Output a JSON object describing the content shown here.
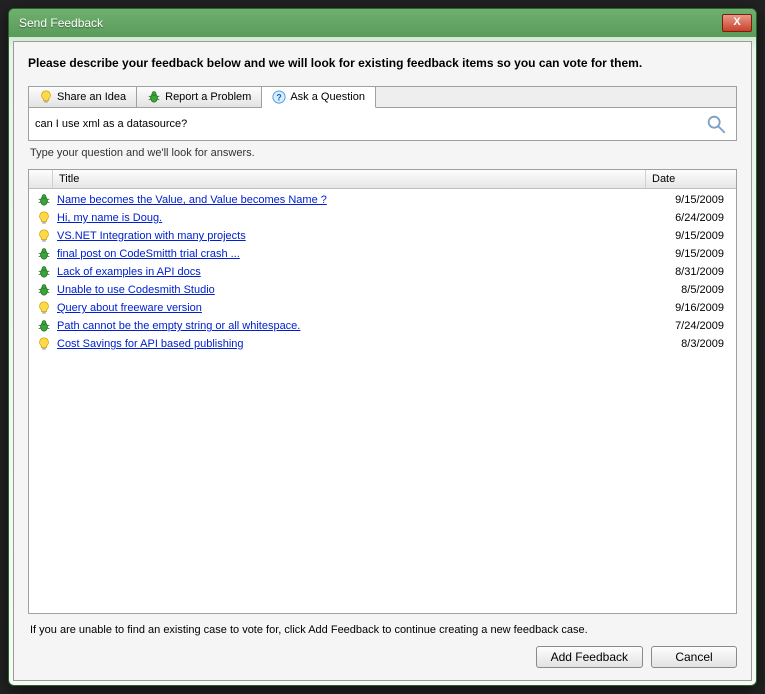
{
  "window": {
    "title": "Send Feedback"
  },
  "headline": "Please describe your feedback below and we will look for existing feedback items so you can vote for them.",
  "tabs": [
    {
      "label": "Share an Idea",
      "icon": "bulb"
    },
    {
      "label": "Report a Problem",
      "icon": "bug"
    },
    {
      "label": "Ask a Question",
      "icon": "question"
    }
  ],
  "active_tab": 2,
  "search": {
    "value": "can I use xml as a datasource?",
    "placeholder": ""
  },
  "hint": "Type your question and we'll look for answers.",
  "columns": {
    "title": "Title",
    "date": "Date"
  },
  "results": [
    {
      "icon": "bug",
      "title": "Name becomes the Value, and Value becomes Name ?",
      "date": "9/15/2009"
    },
    {
      "icon": "bulb",
      "title": "Hi, my name is Doug.",
      "date": "6/24/2009"
    },
    {
      "icon": "bulb",
      "title": "VS.NET Integration with many projects",
      "date": "9/15/2009"
    },
    {
      "icon": "bug",
      "title": "final post on CodeSmitth trial crash ...",
      "date": "9/15/2009"
    },
    {
      "icon": "bug",
      "title": "Lack of examples in API docs",
      "date": "8/31/2009"
    },
    {
      "icon": "bug",
      "title": "Unable to use Codesmith Studio",
      "date": "8/5/2009"
    },
    {
      "icon": "bulb",
      "title": "Query about freeware version",
      "date": "9/16/2009"
    },
    {
      "icon": "bug",
      "title": "Path cannot be the empty string or all whitespace.",
      "date": "7/24/2009"
    },
    {
      "icon": "bulb",
      "title": "Cost Savings for API based publishing",
      "date": "8/3/2009"
    }
  ],
  "bottom_hint": "If you are unable to find an existing case to vote for, click Add Feedback to continue creating a new feedback case.",
  "buttons": {
    "add": "Add Feedback",
    "cancel": "Cancel"
  },
  "icons": {
    "close": "X"
  }
}
